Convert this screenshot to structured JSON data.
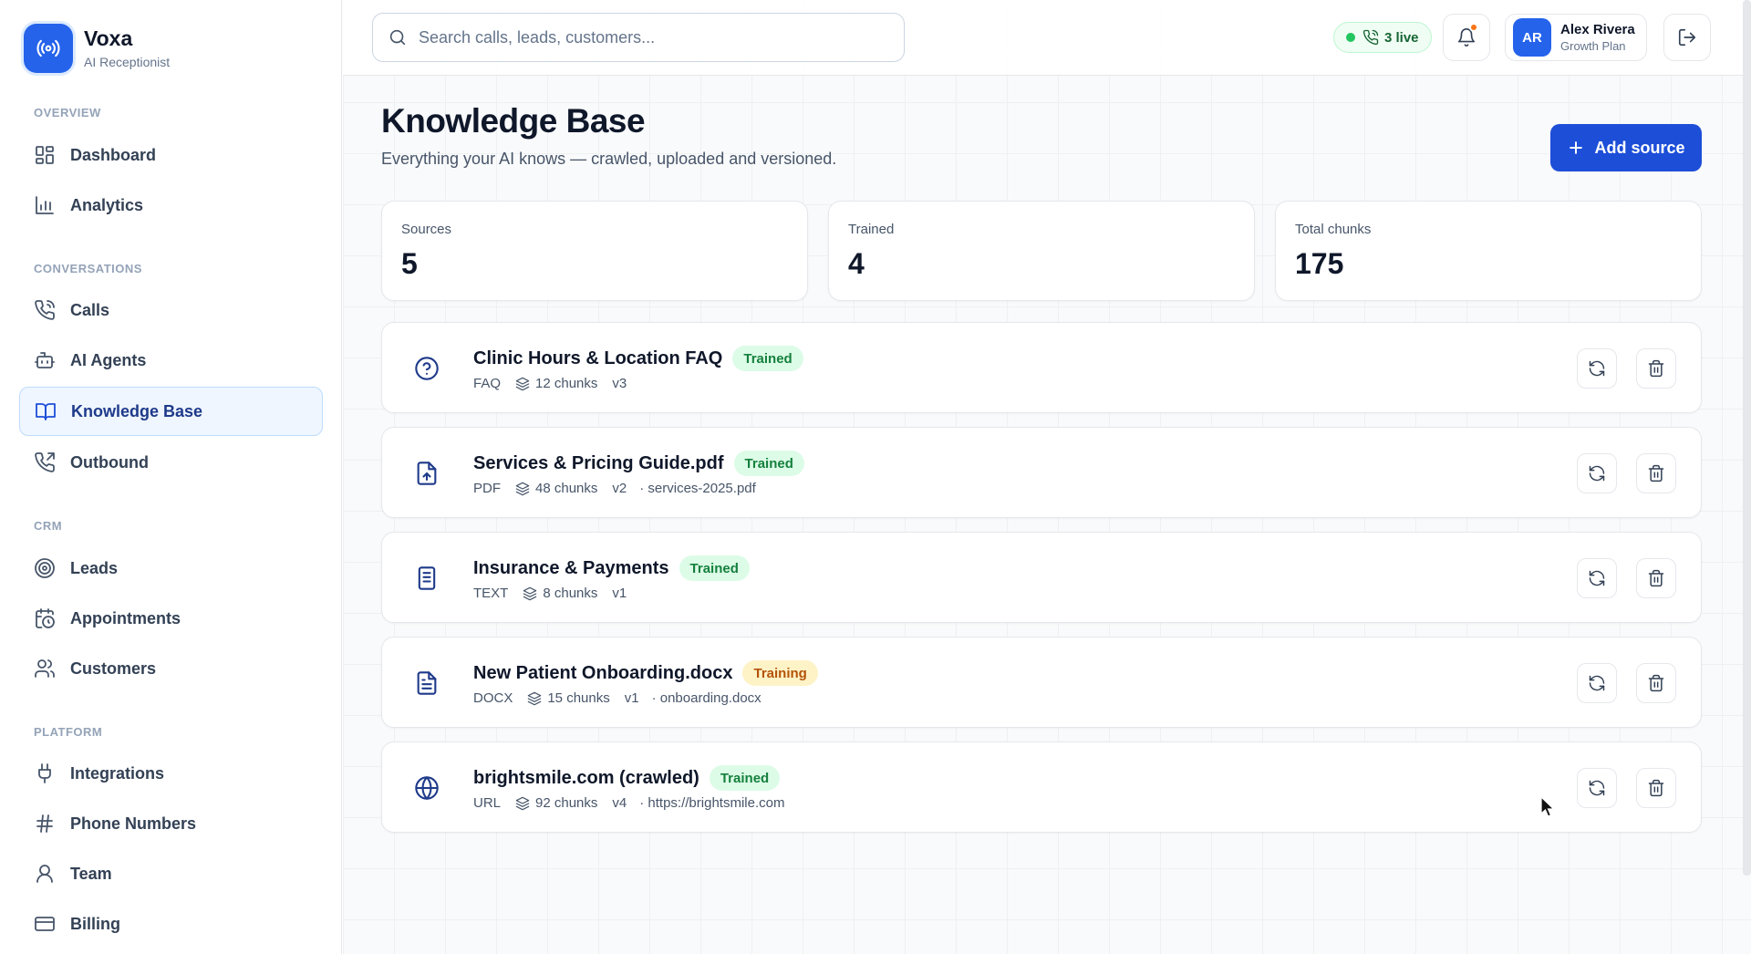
{
  "brand": {
    "name": "Voxa",
    "subtitle": "AI Receptionist",
    "accent": "#2563eb",
    "icon": "broadcast-icon"
  },
  "sidebar": {
    "sections": [
      {
        "title": "OVERVIEW",
        "items": [
          {
            "label": "Dashboard",
            "icon": "dashboard-icon"
          },
          {
            "label": "Analytics",
            "icon": "bar-chart-icon"
          }
        ]
      },
      {
        "title": "CONVERSATIONS",
        "items": [
          {
            "label": "Calls",
            "icon": "phone-icon"
          },
          {
            "label": "AI Agents",
            "icon": "bot-icon"
          },
          {
            "label": "Knowledge Base",
            "icon": "book-icon",
            "active": true
          },
          {
            "label": "Outbound",
            "icon": "phone-outgoing-icon"
          }
        ]
      },
      {
        "title": "CRM",
        "items": [
          {
            "label": "Leads",
            "icon": "target-icon"
          },
          {
            "label": "Appointments",
            "icon": "calendar-clock-icon"
          },
          {
            "label": "Customers",
            "icon": "users-icon"
          }
        ]
      },
      {
        "title": "PLATFORM",
        "items": [
          {
            "label": "Integrations",
            "icon": "plug-icon"
          },
          {
            "label": "Phone Numbers",
            "icon": "hash-icon"
          },
          {
            "label": "Team",
            "icon": "user-icon"
          },
          {
            "label": "Billing",
            "icon": "credit-card-icon"
          }
        ]
      }
    ]
  },
  "topbar": {
    "search_placeholder": "Search calls, leads, customers...",
    "live_count": "3 live",
    "user": {
      "initials": "AR",
      "name": "Alex Rivera",
      "plan": "Growth Plan"
    }
  },
  "page": {
    "title": "Knowledge Base",
    "subtitle": "Everything your AI knows — crawled, uploaded and versioned.",
    "add_button": "Add source"
  },
  "stats": [
    {
      "label": "Sources",
      "value": "5"
    },
    {
      "label": "Trained",
      "value": "4"
    },
    {
      "label": "Total chunks",
      "value": "175"
    }
  ],
  "sources": [
    {
      "name": "Clinic Hours & Location FAQ",
      "status": "Trained",
      "type": "FAQ",
      "chunks": "12 chunks",
      "version": "v3",
      "file": "",
      "icon": "help-circle-icon"
    },
    {
      "name": "Services & Pricing Guide.pdf",
      "status": "Trained",
      "type": "PDF",
      "chunks": "48 chunks",
      "version": "v2",
      "file": "· services-2025.pdf",
      "icon": "file-upload-icon"
    },
    {
      "name": "Insurance & Payments",
      "status": "Trained",
      "type": "TEXT",
      "chunks": "8 chunks",
      "version": "v1",
      "file": "",
      "icon": "text-document-icon"
    },
    {
      "name": "New Patient Onboarding.docx",
      "status": "Training",
      "type": "DOCX",
      "chunks": "15 chunks",
      "version": "v1",
      "file": "· onboarding.docx",
      "icon": "file-text-icon"
    },
    {
      "name": "brightsmile.com (crawled)",
      "status": "Trained",
      "type": "URL",
      "chunks": "92 chunks",
      "version": "v4",
      "file": "· https://brightsmile.com",
      "icon": "globe-icon"
    }
  ],
  "colors": {
    "primary": "#1d4ed8",
    "trained_bg": "#dcfce7",
    "trained_text": "#15803d",
    "training_bg": "#fef3c7",
    "training_text": "#b45309",
    "live": "#22c55e",
    "notification": "#f97316"
  }
}
